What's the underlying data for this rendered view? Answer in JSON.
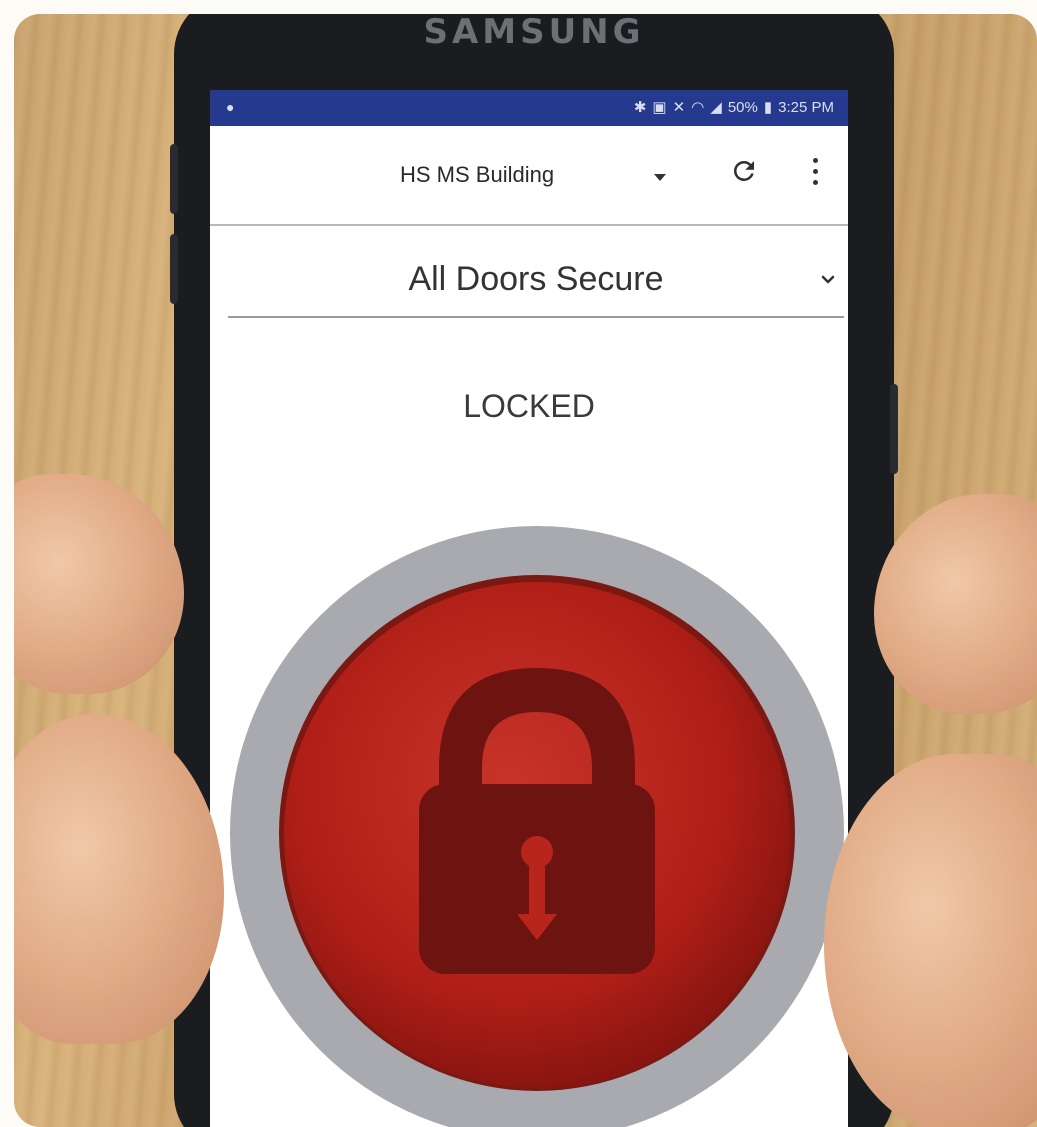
{
  "device": {
    "brand": "SAMSUNG"
  },
  "status_bar": {
    "icons": [
      "bluetooth-icon",
      "nfc-icon",
      "mute-icon",
      "wifi-icon",
      "signal-icon",
      "battery-icon"
    ],
    "battery": "50%",
    "time": "3:25 PM"
  },
  "app_bar": {
    "building_name": "HS MS Building",
    "refresh_icon": "refresh-icon",
    "menu_icon": "more-vert-icon"
  },
  "door_filter": {
    "selected": "All Doors Secure"
  },
  "lock": {
    "state": "LOCKED",
    "icon": "padlock-icon",
    "color": "#b8251c",
    "ring_color": "#a7a9ae"
  }
}
